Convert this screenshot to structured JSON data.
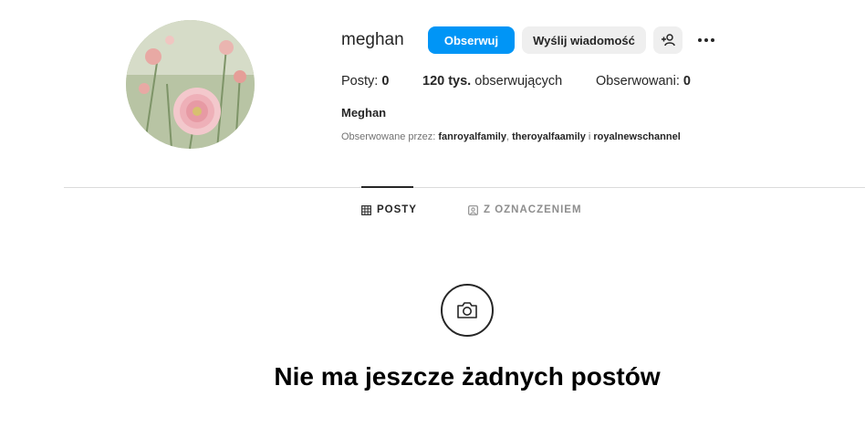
{
  "profile": {
    "username": "meghan",
    "full_name": "Meghan",
    "avatar_icon": "flower-photo"
  },
  "actions": {
    "follow_label": "Obserwuj",
    "message_label": "Wyślij wiadomość",
    "add_user_icon": "add-user-icon",
    "more_icon": "more-options-icon"
  },
  "stats": {
    "posts_label": "Posty:",
    "posts_value": "0",
    "followers_value": "120 tys.",
    "followers_label": "obserwujących",
    "following_label": "Obserwowani:",
    "following_value": "0"
  },
  "followed_by": {
    "prefix": "Obserwowane przez:",
    "accounts": [
      "fanroyalfamily",
      "theroyalfaamily",
      "royalnewschannel"
    ],
    "separator": ",",
    "conjunction": "i"
  },
  "tabs": [
    {
      "label": "POSTY",
      "icon": "grid-icon",
      "active": true
    },
    {
      "label": "Z OZNACZENIEM",
      "icon": "tagged-icon",
      "active": false
    }
  ],
  "empty_state": {
    "icon": "camera-icon",
    "title": "Nie ma jeszcze żadnych postów"
  },
  "colors": {
    "accent": "#0095f6",
    "text": "#262626",
    "muted": "#737373",
    "button_bg": "#efefef",
    "divider": "#dbdbdb"
  }
}
